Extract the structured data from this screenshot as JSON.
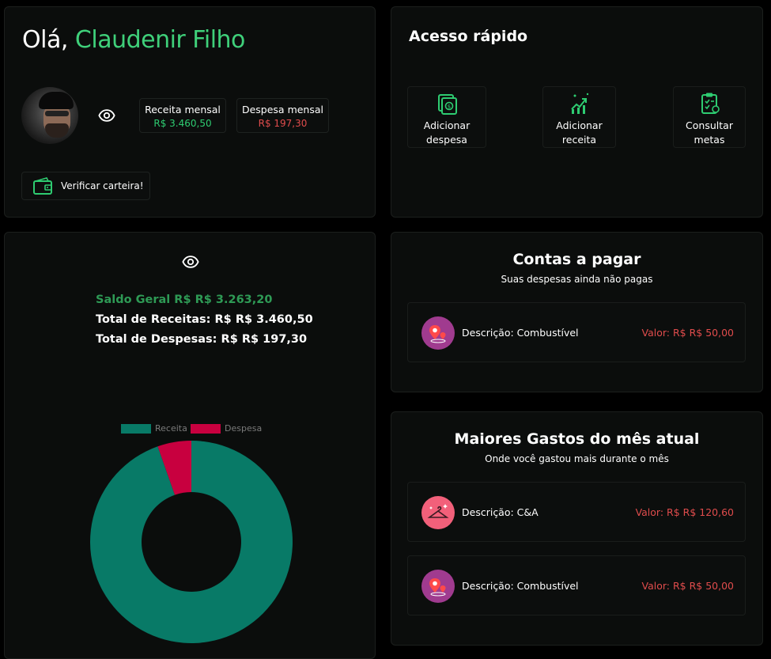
{
  "greeting": {
    "prefix": "Olá, ",
    "name": "Claudenir Filho"
  },
  "summary": {
    "receita_label": "Receita mensal",
    "receita_value": "R$ 3.460,50",
    "despesa_label": "Despesa mensal",
    "despesa_value": "R$ 197,30"
  },
  "wallet": {
    "label": "Verificar carteira!",
    "icon": "wallet-icon"
  },
  "quick_access": {
    "title": "Acesso rápido",
    "items": [
      {
        "label": "Adicionar\ndespesa",
        "icon": "money-expense-icon"
      },
      {
        "label": "Adicionar\nreceita",
        "icon": "money-income-icon"
      },
      {
        "label": "Consultar\nmetas",
        "icon": "clipboard-goals-icon"
      }
    ]
  },
  "balance": {
    "saldo": "Saldo Geral R$ R$ 3.263,20",
    "total_receitas": "Total de Receitas: R$ R$ 3.460,50",
    "total_despesas": "Total de Despesas: R$ R$ 197,30"
  },
  "chart_data": {
    "type": "pie",
    "title": "",
    "categories": [
      "Receita",
      "Despesa"
    ],
    "values": [
      3460.5,
      197.3
    ],
    "colors": [
      "#087a67",
      "#c8003f"
    ],
    "legend_position": "top"
  },
  "bills": {
    "title": "Contas a pagar",
    "subtitle": "Suas despesas ainda não pagas",
    "items": [
      {
        "desc": "Descrição: Combustível",
        "valor": "Valor: R$ R$ 50,00",
        "icon": "location-pin-icon",
        "color": "#a03b8f"
      }
    ]
  },
  "top_expenses": {
    "title": "Maiores Gastos do mês atual",
    "subtitle": "Onde você gastou mais durante o mês",
    "items": [
      {
        "desc": "Descrição: C&A",
        "valor": "Valor: R$ R$ 120,60",
        "icon": "clothes-hanger-icon",
        "color": "#f2607a"
      },
      {
        "desc": "Descrição: Combustível",
        "valor": "Valor: R$ R$ 50,00",
        "icon": "location-pin-icon",
        "color": "#a03b8f"
      }
    ]
  },
  "colors": {
    "accent_green": "#3fd07a",
    "income_green": "#2ecc71",
    "expense_red": "#e04c4c"
  }
}
